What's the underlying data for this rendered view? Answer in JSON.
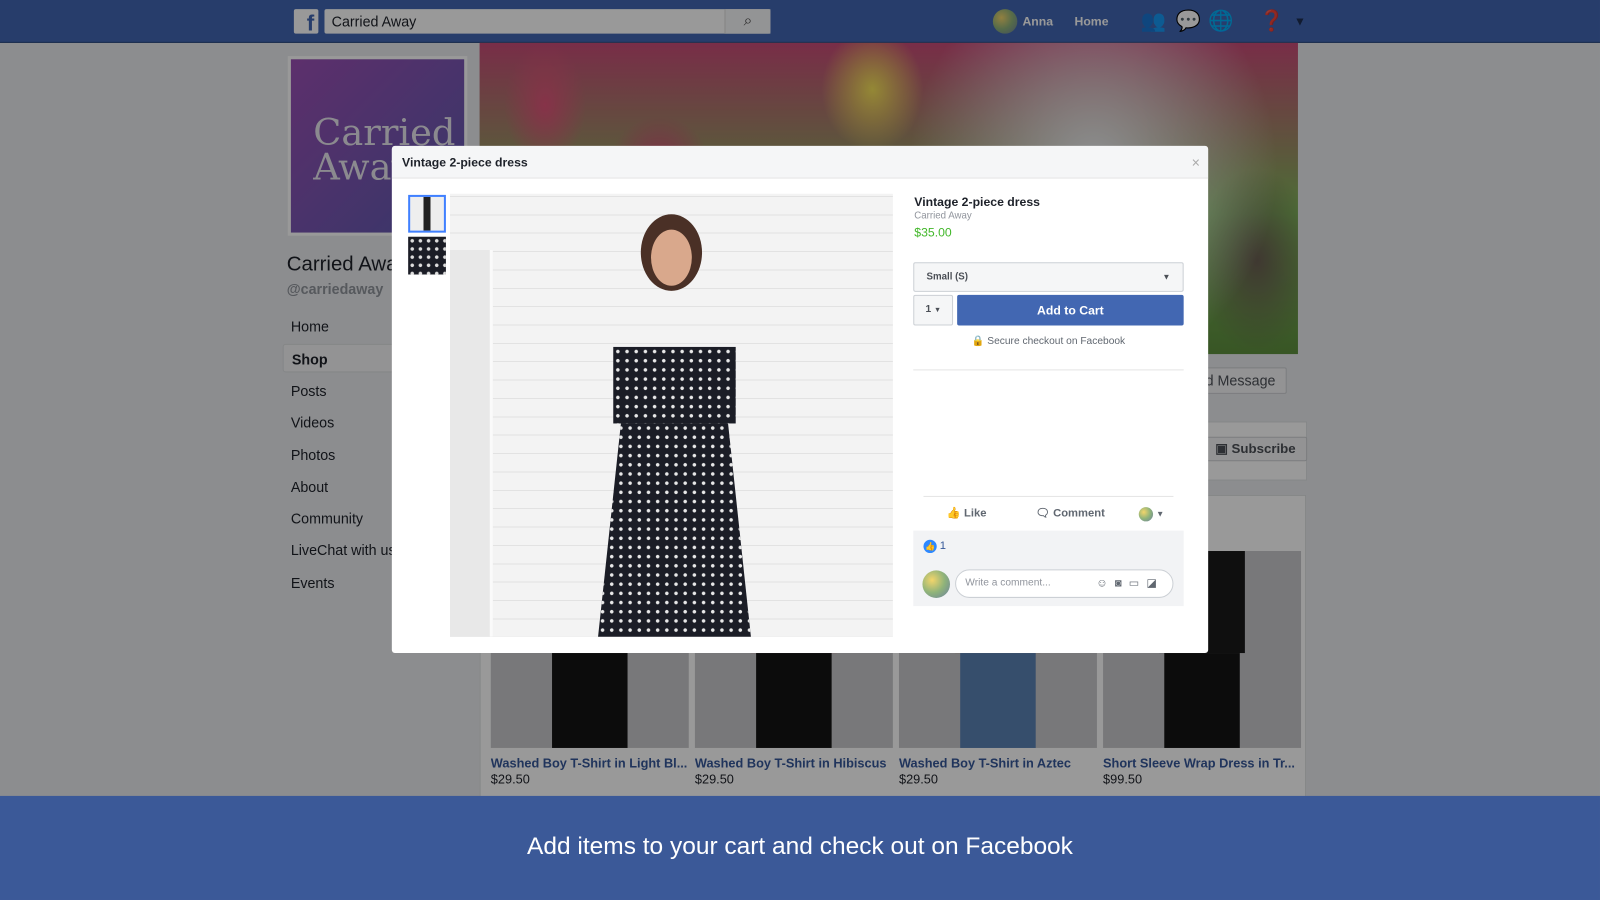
{
  "topbar": {
    "search_value": "Carried Away",
    "user": "Anna",
    "home": "Home"
  },
  "page": {
    "logo_line1": "Carried",
    "logo_line2": "Away",
    "name": "Carried Away",
    "handle": "@carriedaway",
    "nav": [
      {
        "label": "Home"
      },
      {
        "label": "Shop",
        "active": true
      },
      {
        "label": "Posts"
      },
      {
        "label": "Videos"
      },
      {
        "label": "Photos"
      },
      {
        "label": "About"
      },
      {
        "label": "Community"
      },
      {
        "label": "LiveChat with us"
      },
      {
        "label": "Events"
      }
    ],
    "send_message": "Send Message",
    "subscribe": "Subscribe"
  },
  "products": [
    {
      "title": "Washed Boy T-Shirt in Light Bl...",
      "price": "$29.50",
      "color": "#d8dfe8"
    },
    {
      "title": "Washed Boy T-Shirt in Hibiscus",
      "price": "$29.50",
      "color": "#e0323c"
    },
    {
      "title": "Washed Boy T-Shirt in Aztec",
      "price": "$29.50",
      "color": "#9a5c3a"
    },
    {
      "title": "Short Sleeve Wrap Dress in Tr...",
      "price": "$99.50",
      "color": "#1a1a1a"
    }
  ],
  "modal": {
    "header": "Vintage 2-piece dress",
    "title": "Vintage 2-piece dress",
    "shop": "Carried Away",
    "price": "$35.00",
    "size": "Small (S)",
    "qty": "1",
    "add_to_cart": "Add to Cart",
    "secure": "Secure checkout on Facebook",
    "like": "Like",
    "comment": "Comment",
    "like_count": "1",
    "comment_placeholder": "Write a comment...",
    "close": "×"
  },
  "banner": "Add items to your cart and check out on Facebook",
  "colors": {
    "brand": "#4267b2",
    "price": "#42b72a",
    "banner": "#3b5998"
  }
}
